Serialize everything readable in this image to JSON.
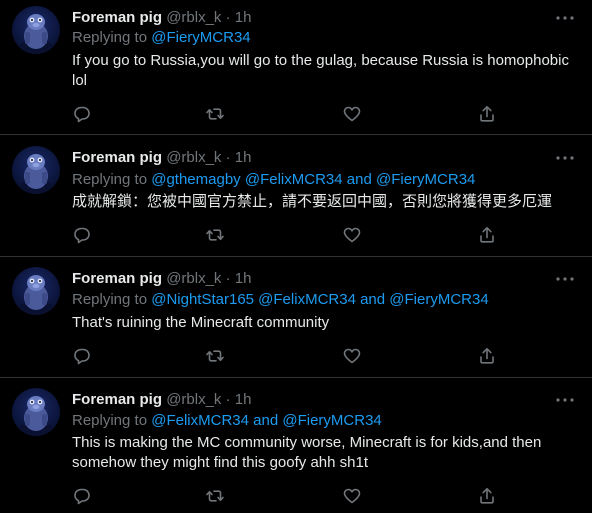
{
  "tweets": [
    {
      "name": "Foreman pig",
      "handle": "@rblx_k",
      "dot": "·",
      "time": "1h",
      "replying_prefix": "Replying to",
      "mentions": [
        "@FieryMCR34"
      ],
      "connectors": [],
      "text": "If you go to Russia,you will go to the gulag, because Russia is homophobic lol"
    },
    {
      "name": "Foreman pig",
      "handle": "@rblx_k",
      "dot": "·",
      "time": "1h",
      "replying_prefix": "Replying to",
      "mentions": [
        "@gthemagby",
        "@FelixMCR34",
        "@FieryMCR34"
      ],
      "connectors": [
        " ",
        " and "
      ],
      "text": "成就解鎖：您被中國官方禁止，請不要返回中國，否則您將獲得更多厄運"
    },
    {
      "name": "Foreman pig",
      "handle": "@rblx_k",
      "dot": "·",
      "time": "1h",
      "replying_prefix": "Replying to",
      "mentions": [
        "@NightStar165",
        "@FelixMCR34",
        "@FieryMCR34"
      ],
      "connectors": [
        " ",
        " and "
      ],
      "text": "That's ruining the Minecraft community"
    },
    {
      "name": "Foreman pig",
      "handle": "@rblx_k",
      "dot": "·",
      "time": "1h",
      "replying_prefix": "Replying to",
      "mentions": [
        "@FelixMCR34",
        "@FieryMCR34"
      ],
      "connectors": [
        " and "
      ],
      "text": "This is making the MC community worse, Minecraft is for kids,and then somehow they might find this goofy ahh sh1t"
    }
  ],
  "icons": {
    "more": "more-horizontal-icon",
    "reply": "reply-icon",
    "retweet": "retweet-icon",
    "like": "heart-icon",
    "share": "share-icon"
  },
  "colors": {
    "background": "#000000",
    "text": "#e7e9ea",
    "secondary": "#71767b",
    "mention": "#1d9bf0",
    "divider": "#2f3336"
  }
}
